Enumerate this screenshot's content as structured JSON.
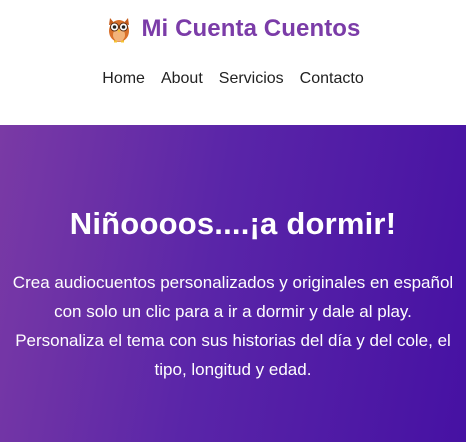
{
  "brand": {
    "logo_icon": "owl-icon",
    "title": "Mi Cuenta Cuentos",
    "title_color": "#7b3ca8"
  },
  "nav": {
    "items": [
      {
        "label": "Home"
      },
      {
        "label": "About"
      },
      {
        "label": "Servicios"
      },
      {
        "label": "Contacto"
      }
    ]
  },
  "hero": {
    "title": "Niñoooos....¡a dormir!",
    "description": "Crea audiocuentos personalizados y originales en español con solo un clic para a ir a dormir y dale al play. Personaliza el tema con sus historias del día y del cole, el tipo, longitud y edad.",
    "gradient_start": "#7a3aa5",
    "gradient_end": "#4611a3"
  }
}
